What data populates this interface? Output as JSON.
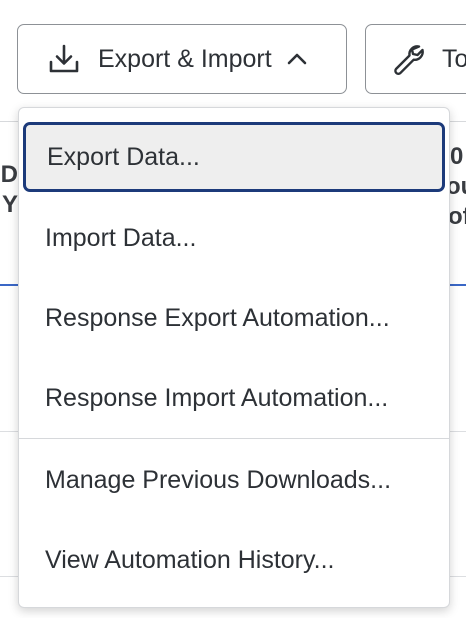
{
  "toolbar": {
    "export_import_label": "Export & Import",
    "tools_label": "To"
  },
  "background": {
    "col1_line1": "ID",
    "col1_line2": "Y",
    "col2_line1": "0",
    "col2_line2": "ou",
    "col2_line3": "of"
  },
  "menu": {
    "items": [
      {
        "label": "Export Data..."
      },
      {
        "label": "Import Data..."
      },
      {
        "label": "Response Export Automation..."
      },
      {
        "label": "Response Import Automation..."
      },
      {
        "label": "Manage Previous Downloads..."
      },
      {
        "label": "View Automation History..."
      }
    ]
  },
  "colors": {
    "focus_border": "#1c3a7a",
    "focus_fill": "#eeeeee",
    "accent_line": "#3a67c6",
    "text": "#2d3136"
  },
  "icons": {
    "export": "download-tray-icon",
    "chevron": "chevron-up-icon",
    "tools": "wrench-icon"
  }
}
